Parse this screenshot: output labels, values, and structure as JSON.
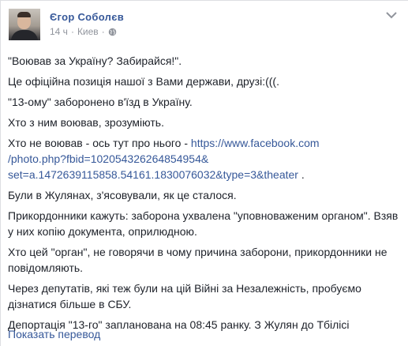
{
  "post": {
    "author": "Єгор Соболєв",
    "time": "14 ч",
    "separator": "·",
    "location": "Киев",
    "privacy_icon": "globe-icon",
    "menu_icon": "chevron-down-icon",
    "paragraphs": [
      "\"Воював за Україну? Забирайся!\".",
      "Це офіційна позиція нашої з Вами держави, друзі:(((.",
      "\"13-ому\" заборонено в'їзд в Україну.",
      "Хто з ним воював, зрозуміють."
    ],
    "link_paragraph": {
      "prefix": "Хто не воював - ось тут про нього - ",
      "link_line1": "https://www.facebook.com",
      "link_line2": "/photo.php?fbid=10205432626485495‌4&",
      "link_line3": "set=a.1472639115858.54161.1830076032&type=3&theater",
      "suffix": " ."
    },
    "paragraphs_after": [
      "Були в Жулянах, з'ясовували, як це сталося.",
      "Прикордонники кажуть: заборона ухвалена \"уповноваженим органом\". Взяв у них копію документа, оприлюдною.",
      "Хто цей \"орган\", не говорячи в чому причина заборони, прикордонники не повідомляють.",
      "Через депутатів, які теж були на цій Війні за Незалежність, пробуємо дізнатися більше в СБУ.",
      "Депортація \"13-го\" запланована на 08:45 ранку. З Жулян до Тбілісі"
    ],
    "translate_label": "Показать перевод"
  }
}
